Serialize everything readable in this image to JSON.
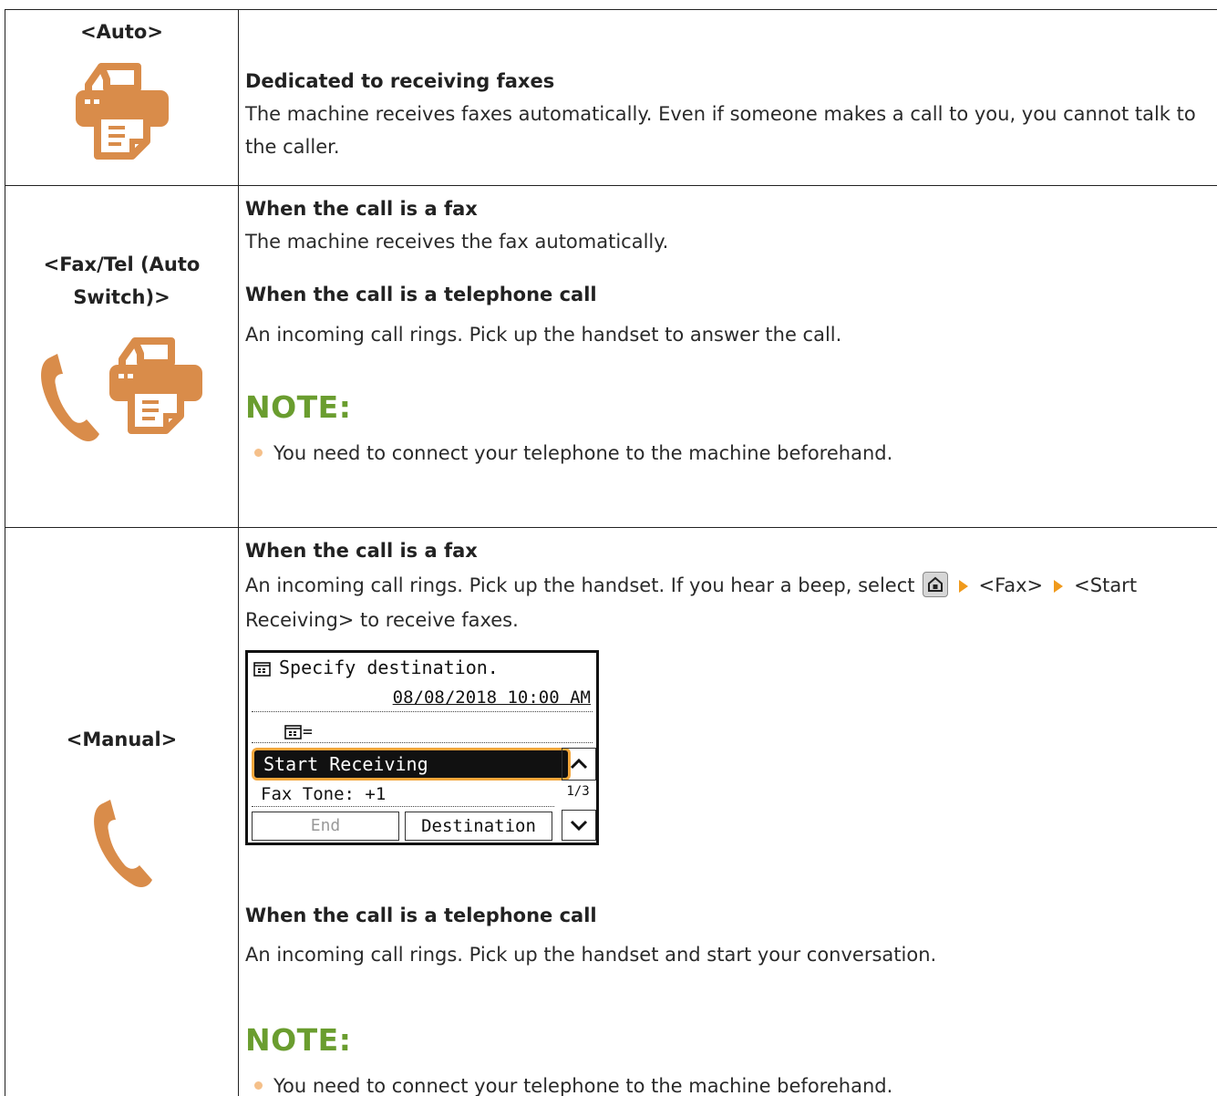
{
  "rows": [
    {
      "mode": "<Auto>",
      "heading": "Dedicated to receiving faxes",
      "text": "The machine receives faxes automatically. Even if someone makes a call to you, you cannot talk to the caller."
    },
    {
      "mode_line1": "<Fax/Tel (Auto",
      "mode_line2": "Switch)>",
      "fax_heading": "When the call is a fax",
      "fax_text": "The machine receives the fax automatically.",
      "tel_heading": "When the call is a telephone call",
      "tel_text": "An incoming call rings. Pick up the handset to answer the call.",
      "note_title": "NOTE:",
      "note_text": "You need to connect your telephone to the machine beforehand."
    },
    {
      "mode": "<Manual>",
      "fax_heading": "When the call is a fax",
      "fax_text_before": "An incoming call rings. Pick up the handset. If you hear a beep, select",
      "fax_step1": "<Fax>",
      "fax_step2": "<Start",
      "fax_text_after": "Receiving> to receive faxes.",
      "screen": {
        "title": "Specify destination.",
        "datetime": "08/08/2018 10:00 AM",
        "input_prefix": "=",
        "selected_item": "Start Receiving",
        "item2": "Fax Tone: +1",
        "page": "1/3",
        "btn_end": "End",
        "btn_destination": "Destination"
      },
      "tel_heading": "When the call is a telephone call",
      "tel_text": "An incoming call rings. Pick up the handset and start your conversation.",
      "note_title": "NOTE:",
      "note_text": "You need to connect your telephone to the machine beforehand."
    }
  ],
  "colors": {
    "icon": "#d98c4a",
    "note": "#6a9d2f",
    "arrow": "#f09a1c"
  }
}
